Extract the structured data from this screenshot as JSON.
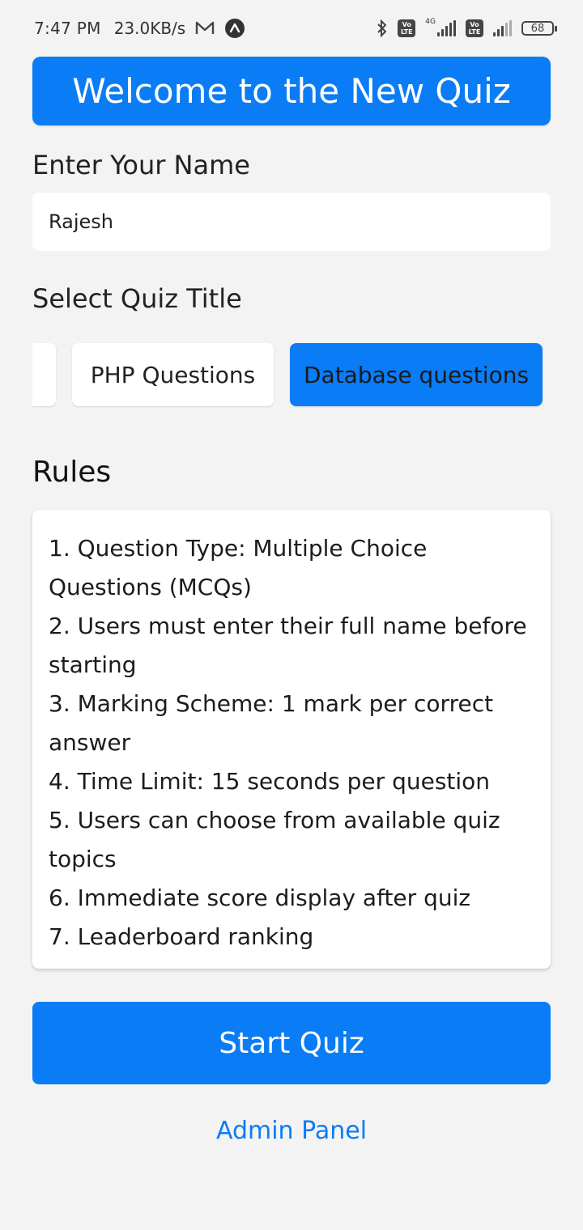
{
  "status_bar": {
    "time": "7:47 PM",
    "speed": "23.0KB/s",
    "network_type": "4G",
    "volte_top": "Vo",
    "volte_bottom": "LTE",
    "battery": "68",
    "icons": [
      "mail-icon",
      "navigation-icon",
      "bluetooth-icon",
      "signal-icon",
      "battery-icon"
    ]
  },
  "header": {
    "title": "Welcome to the New Quiz"
  },
  "name_section": {
    "label": "Enter Your Name",
    "value": "Rajesh"
  },
  "quiz_section": {
    "label": "Select Quiz Title",
    "options": [
      "",
      "PHP Questions",
      "Database questions"
    ],
    "selected": "Database questions"
  },
  "rules": {
    "title": "Rules",
    "items": [
      "1. Question Type: Multiple Choice Questions (MCQs)",
      "2. Users must enter their full name before starting",
      "3. Marking Scheme: 1 mark per correct answer",
      "4. Time Limit: 15 seconds per question",
      "5. Users can choose from available quiz topics",
      "6. Immediate score display after quiz",
      "7. Leaderboard ranking"
    ]
  },
  "actions": {
    "start_label": "Start Quiz",
    "admin_label": "Admin Panel"
  },
  "colors": {
    "primary": "#0a7cf5",
    "background": "#f3f3f3",
    "card": "#ffffff"
  }
}
